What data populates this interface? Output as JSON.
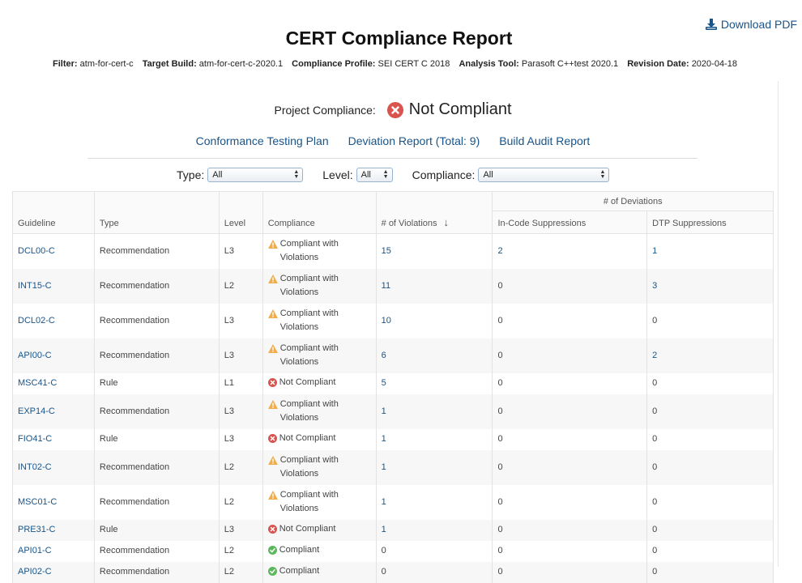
{
  "header": {
    "download_label": "Download PDF",
    "title": "CERT Compliance Report",
    "meta": [
      {
        "label": "Filter:",
        "value": "atm-for-cert-c"
      },
      {
        "label": "Target Build:",
        "value": "atm-for-cert-c-2020.1"
      },
      {
        "label": "Compliance Profile:",
        "value": "SEI CERT C 2018"
      },
      {
        "label": "Analysis Tool:",
        "value": "Parasoft C++test 2020.1"
      },
      {
        "label": "Revision Date:",
        "value": "2020-04-18"
      }
    ]
  },
  "project": {
    "label": "Project Compliance:",
    "status": "Not Compliant",
    "status_icon": "error-circle-icon",
    "status_color": "#d9534f"
  },
  "links": {
    "testing_plan": "Conformance Testing Plan",
    "deviation_report": "Deviation Report (Total: 9)",
    "build_audit": "Build Audit Report"
  },
  "filters": {
    "type_label": "Type:",
    "type_value": "All",
    "level_label": "Level:",
    "level_value": "All",
    "compliance_label": "Compliance:",
    "compliance_value": "All"
  },
  "table": {
    "headers": {
      "guideline": "Guideline",
      "type": "Type",
      "level": "Level",
      "compliance": "Compliance",
      "violations": "# of Violations",
      "deviations_group": "# of Deviations",
      "in_code": "In-Code Suppressions",
      "dtp": "DTP Suppressions"
    },
    "sort_icon": "sort-down-arrow-icon",
    "rows": [
      {
        "guideline": "DCL00-C",
        "type": "Recommendation",
        "level": "L3",
        "status": "warn",
        "compliance": "Compliant with Violations",
        "violations": "15",
        "in_code": "2",
        "dtp": "1"
      },
      {
        "guideline": "INT15-C",
        "type": "Recommendation",
        "level": "L2",
        "status": "warn",
        "compliance": "Compliant with Violations",
        "violations": "11",
        "in_code": "0",
        "dtp": "3"
      },
      {
        "guideline": "DCL02-C",
        "type": "Recommendation",
        "level": "L3",
        "status": "warn",
        "compliance": "Compliant with Violations",
        "violations": "10",
        "in_code": "0",
        "dtp": "0"
      },
      {
        "guideline": "API00-C",
        "type": "Recommendation",
        "level": "L3",
        "status": "warn",
        "compliance": "Compliant with Violations",
        "violations": "6",
        "in_code": "0",
        "dtp": "2"
      },
      {
        "guideline": "MSC41-C",
        "type": "Rule",
        "level": "L1",
        "status": "error",
        "compliance": "Not Compliant",
        "violations": "5",
        "in_code": "0",
        "dtp": "0"
      },
      {
        "guideline": "EXP14-C",
        "type": "Recommendation",
        "level": "L3",
        "status": "warn",
        "compliance": "Compliant with Violations",
        "violations": "1",
        "in_code": "0",
        "dtp": "0"
      },
      {
        "guideline": "FIO41-C",
        "type": "Rule",
        "level": "L3",
        "status": "error",
        "compliance": "Not Compliant",
        "violations": "1",
        "in_code": "0",
        "dtp": "0"
      },
      {
        "guideline": "INT02-C",
        "type": "Recommendation",
        "level": "L2",
        "status": "warn",
        "compliance": "Compliant with Violations",
        "violations": "1",
        "in_code": "0",
        "dtp": "0"
      },
      {
        "guideline": "MSC01-C",
        "type": "Recommendation",
        "level": "L2",
        "status": "warn",
        "compliance": "Compliant with Violations",
        "violations": "1",
        "in_code": "0",
        "dtp": "0"
      },
      {
        "guideline": "PRE31-C",
        "type": "Rule",
        "level": "L3",
        "status": "error",
        "compliance": "Not Compliant",
        "violations": "1",
        "in_code": "0",
        "dtp": "0"
      },
      {
        "guideline": "API01-C",
        "type": "Recommendation",
        "level": "L2",
        "status": "ok",
        "compliance": "Compliant",
        "violations": "0",
        "in_code": "0",
        "dtp": "0"
      },
      {
        "guideline": "API02-C",
        "type": "Recommendation",
        "level": "L2",
        "status": "ok",
        "compliance": "Compliant",
        "violations": "0",
        "in_code": "0",
        "dtp": "0"
      }
    ]
  },
  "colors": {
    "link": "#17548a",
    "warn": "#f0ad4e",
    "error": "#d9534f",
    "ok": "#5cb85c"
  }
}
